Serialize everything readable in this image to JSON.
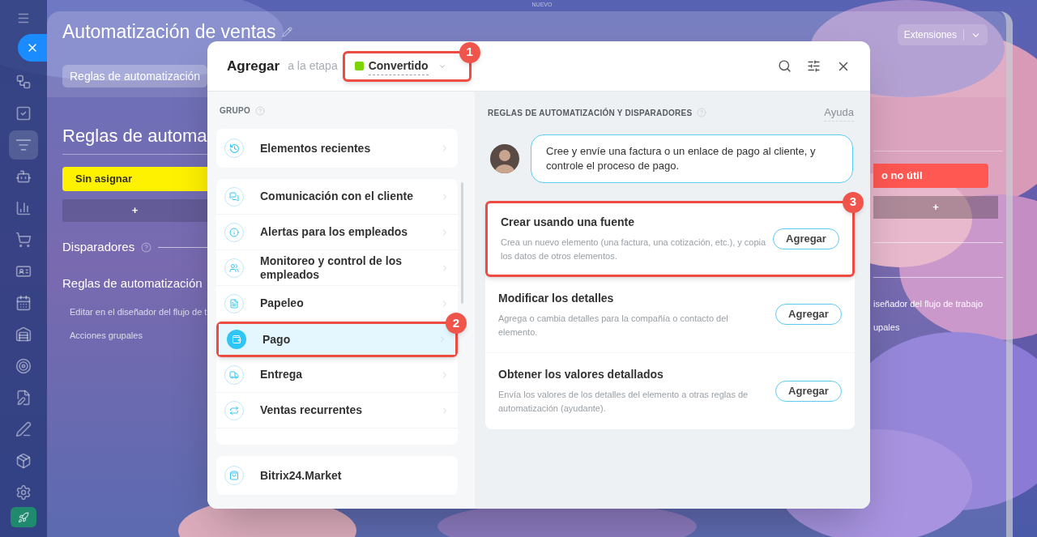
{
  "top_label": "NUEVO",
  "sidebar": {
    "items": [
      {
        "selected": false
      },
      {
        "selected": false
      },
      {
        "selected": true
      },
      {
        "selected": false
      },
      {
        "selected": false
      },
      {
        "selected": false
      },
      {
        "selected": false
      },
      {
        "selected": false
      },
      {
        "selected": false
      },
      {
        "selected": false
      },
      {
        "selected": false
      },
      {
        "selected": false
      },
      {
        "selected": false
      },
      {
        "selected": false
      }
    ]
  },
  "page": {
    "title": "Automatización de ventas",
    "tab": "Reglas de automatización",
    "extensions": "Extensiones",
    "heading": "Reglas de automa",
    "stages": [
      {
        "name": "Sin asignar",
        "color": "#fff200"
      },
      {
        "name": "o no útil",
        "color": "#ff5752"
      }
    ],
    "add_label": "+",
    "triggers_label": "Disparadores",
    "rules_label": "Reglas de automatización",
    "links_left": [
      "Editar en el diseñador del flujo de t",
      "Acciones grupales"
    ],
    "links_right": [
      "iseñador del flujo de trabajo",
      "upales"
    ]
  },
  "dialog": {
    "title": "Agregar",
    "subtitle": "a la etapa",
    "stage": {
      "name": "Convertido",
      "color": "#7bd500"
    },
    "group_label": "GRUPO",
    "recent": "Elementos recientes",
    "groups": [
      {
        "label": "Comunicación con el cliente",
        "selected": false
      },
      {
        "label": "Alertas para los empleados",
        "selected": false
      },
      {
        "label": "Monitoreo y control de los empleados",
        "selected": false
      },
      {
        "label": "Papeleo",
        "selected": false
      },
      {
        "label": "Pago",
        "selected": true
      },
      {
        "label": "Entrega",
        "selected": false
      },
      {
        "label": "Ventas recurrentes",
        "selected": false
      }
    ],
    "market": "Bitrix24.Market",
    "rules_label": "REGLAS DE AUTOMATIZACIÓN Y DISPARADORES",
    "help": "Ayuda",
    "tip": "Cree y envíe una factura o un enlace de pago al cliente, y controle el proceso de pago.",
    "rules": [
      {
        "title": "Crear usando una fuente",
        "description": "Crea un nuevo elemento (una factura, una cotización, etc.), y copia los datos de otros elementos.",
        "button": "Agregar"
      },
      {
        "title": "Modificar los detalles",
        "description": "Agrega o cambia detalles para la compañía o contacto del elemento.",
        "button": "Agregar"
      },
      {
        "title": "Obtener los valores detallados",
        "description": "Envía los valores de los detalles del elemento a otras reglas de automatización (ayudante).",
        "button": "Agregar"
      }
    ]
  },
  "annotations": [
    "1",
    "2",
    "3"
  ]
}
